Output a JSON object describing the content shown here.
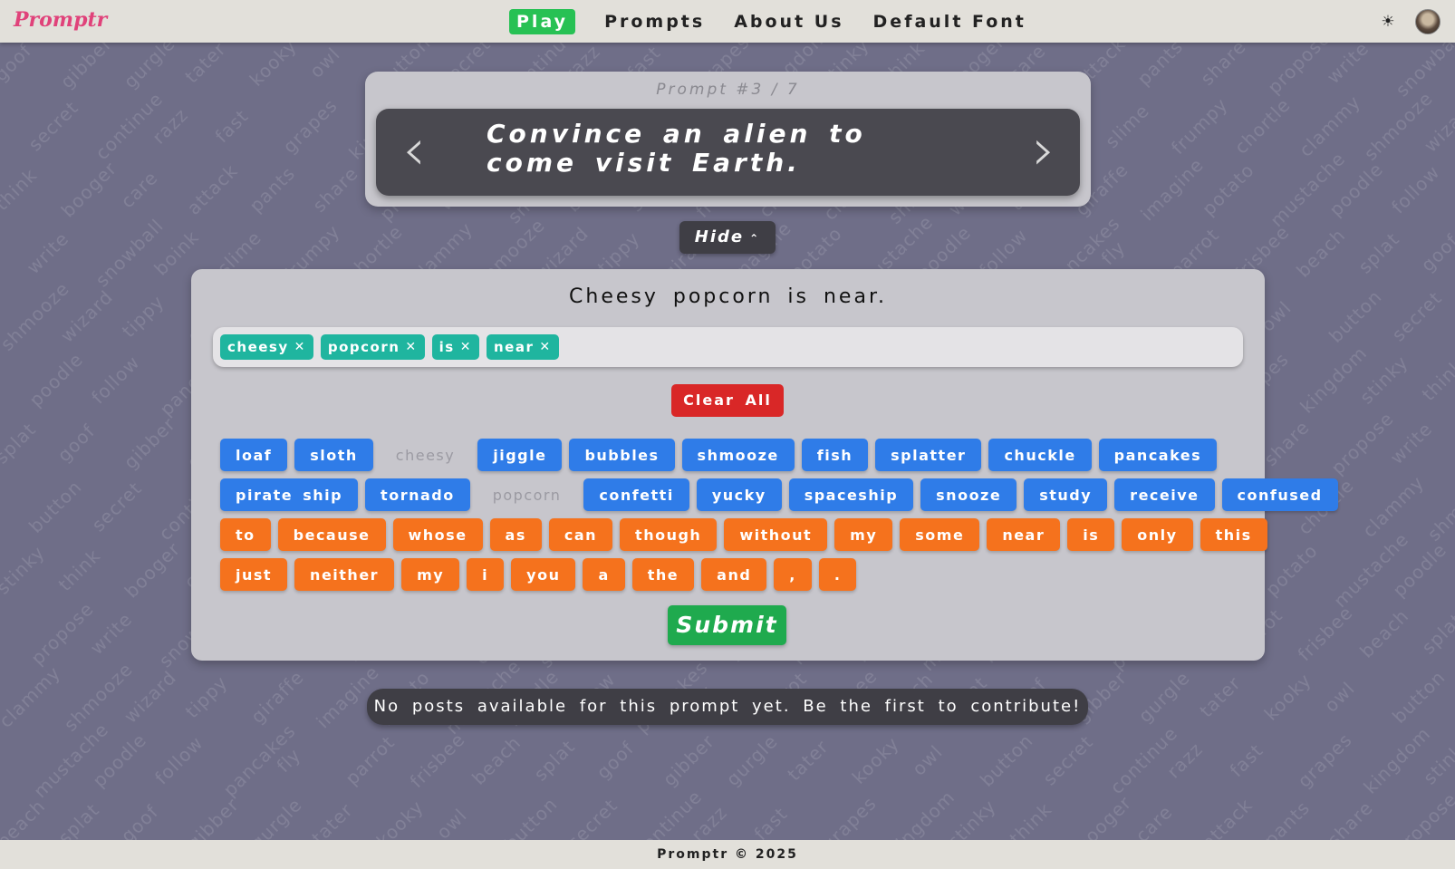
{
  "app": {
    "logo": "Promptr"
  },
  "nav": {
    "items": [
      {
        "label": "Play",
        "active": true
      },
      {
        "label": "Prompts",
        "active": false
      },
      {
        "label": "About Us",
        "active": false
      },
      {
        "label": "Default Font",
        "active": false
      }
    ],
    "theme_icon": "sun-icon",
    "avatar_icon": "user-avatar"
  },
  "prompt": {
    "counter": "Prompt #3 / 7",
    "text": "Convince an alien to come visit Earth.",
    "prev_icon": "chevron-left-icon",
    "next_icon": "chevron-right-icon"
  },
  "hide_button": {
    "label": "Hide",
    "icon": "chevron-up-icon"
  },
  "composer": {
    "sentence": "Cheesy popcorn is near.",
    "chips": [
      "cheesy",
      "popcorn",
      "is",
      "near"
    ],
    "clear_label": "Clear All",
    "submit_label": "Submit",
    "rows": [
      [
        {
          "w": "loaf",
          "c": "blue"
        },
        {
          "w": "sloth",
          "c": "blue"
        },
        {
          "w": "cheesy",
          "c": "used"
        },
        {
          "w": "jiggle",
          "c": "blue"
        },
        {
          "w": "bubbles",
          "c": "blue"
        },
        {
          "w": "shmooze",
          "c": "blue"
        },
        {
          "w": "fish",
          "c": "blue"
        },
        {
          "w": "splatter",
          "c": "blue"
        },
        {
          "w": "chuckle",
          "c": "blue"
        },
        {
          "w": "pancakes",
          "c": "blue"
        }
      ],
      [
        {
          "w": "pirate ship",
          "c": "blue"
        },
        {
          "w": "tornado",
          "c": "blue"
        },
        {
          "w": "popcorn",
          "c": "used"
        },
        {
          "w": "confetti",
          "c": "blue"
        },
        {
          "w": "yucky",
          "c": "blue"
        },
        {
          "w": "spaceship",
          "c": "blue"
        },
        {
          "w": "snooze",
          "c": "blue"
        },
        {
          "w": "study",
          "c": "blue"
        },
        {
          "w": "receive",
          "c": "blue"
        },
        {
          "w": "confused",
          "c": "blue"
        }
      ],
      [
        {
          "w": "to",
          "c": "orange"
        },
        {
          "w": "because",
          "c": "orange"
        },
        {
          "w": "whose",
          "c": "orange"
        },
        {
          "w": "as",
          "c": "orange"
        },
        {
          "w": "can",
          "c": "orange"
        },
        {
          "w": "though",
          "c": "orange"
        },
        {
          "w": "without",
          "c": "orange"
        },
        {
          "w": "my",
          "c": "orange"
        },
        {
          "w": "some",
          "c": "orange"
        },
        {
          "w": "near",
          "c": "orange"
        },
        {
          "w": "is",
          "c": "orange"
        },
        {
          "w": "only",
          "c": "orange"
        },
        {
          "w": "this",
          "c": "orange"
        }
      ],
      [
        {
          "w": "just",
          "c": "orange"
        },
        {
          "w": "neither",
          "c": "orange"
        },
        {
          "w": "my",
          "c": "orange"
        },
        {
          "w": "i",
          "c": "orange"
        },
        {
          "w": "you",
          "c": "orange"
        },
        {
          "w": "a",
          "c": "orange"
        },
        {
          "w": "the",
          "c": "orange"
        },
        {
          "w": "and",
          "c": "orange"
        },
        {
          "w": ",",
          "c": "orange"
        },
        {
          "w": ".",
          "c": "orange"
        }
      ]
    ]
  },
  "notice": "No posts available for this prompt yet. Be the first to contribute!",
  "footer": "Promptr © 2025",
  "background_words": [
    "goof",
    "gibber",
    "gurgle",
    "tater",
    "kooky",
    "owl",
    "button",
    "secret",
    "continue",
    "razz",
    "fast",
    "grapes",
    "kingdom",
    "stinky",
    "think",
    "booger",
    "care",
    "attack",
    "pants",
    "share",
    "propose",
    "write",
    "snowball",
    "boink",
    "slime",
    "frumpy",
    "chortle",
    "clammy",
    "shmooze",
    "wizard",
    "tippy",
    "giraffe",
    "imagine",
    "potato",
    "mustache",
    "poodle",
    "follow",
    "pancakes",
    "fly",
    "parrot",
    "frisbee",
    "beach",
    "splat"
  ],
  "colors": {
    "background": "#6f6e88",
    "nav_active": "#27c154",
    "chip": "#1fb59f",
    "clear": "#d92727",
    "noun": "#2f7ce8",
    "connector": "#f5721d",
    "submit": "#1faa4e",
    "logo": "#e0427a"
  }
}
